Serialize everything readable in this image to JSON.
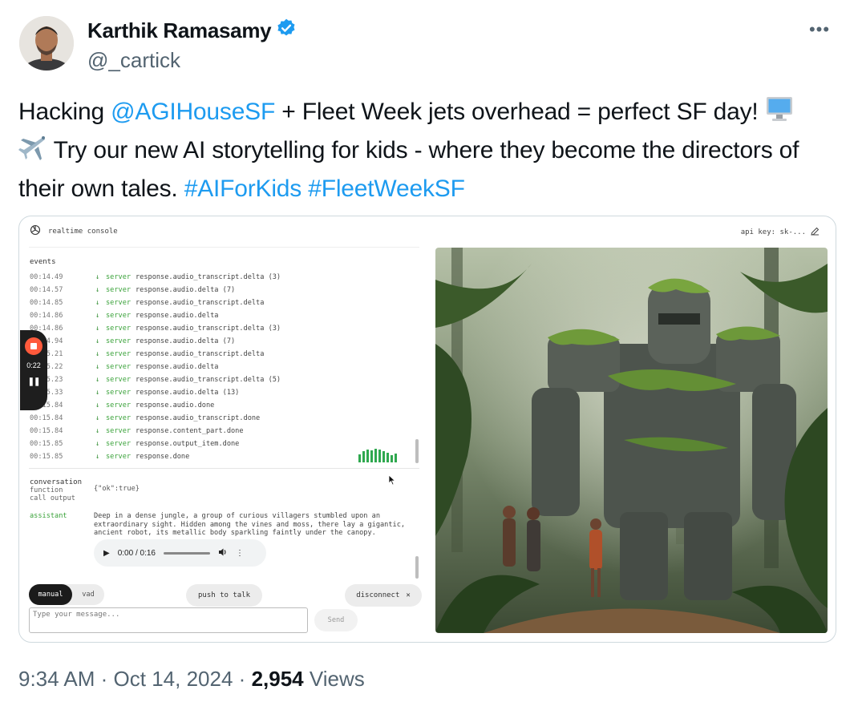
{
  "author": {
    "display_name": "Karthik Ramasamy",
    "handle": "@_cartick",
    "verified_icon": "verified-badge-icon"
  },
  "more_icon": "more-horizontal-icon",
  "tweet": {
    "part1": "Hacking ",
    "mention": "@AGIHouseSF",
    "part2": " + Fleet Week jets overhead = perfect SF day! ",
    "emoji_computer": "computer-emoji",
    "emoji_airplane": "airplane-emoji",
    "part3": " Try our new AI storytelling for kids - where they become the directors of their own tales. ",
    "hashtag1": "#AIForKids",
    "hashtag2": "#FleetWeekSF",
    "link_color": "#1d9bf0"
  },
  "console": {
    "app_name": "realtime console",
    "logo_icon": "openai-logo-icon",
    "api_key_label": "api key: sk-...",
    "edit_icon": "edit-icon",
    "events_title": "events",
    "events": [
      {
        "ts": "00:14.49",
        "src": "server",
        "type": "response.audio_transcript.delta (3)"
      },
      {
        "ts": "00:14.57",
        "src": "server",
        "type": "response.audio.delta (7)"
      },
      {
        "ts": "00:14.85",
        "src": "server",
        "type": "response.audio_transcript.delta"
      },
      {
        "ts": "00:14.86",
        "src": "server",
        "type": "response.audio.delta"
      },
      {
        "ts": "00:14.86",
        "src": "server",
        "type": "response.audio_transcript.delta (3)"
      },
      {
        "ts": "00:14.94",
        "src": "server",
        "type": "response.audio.delta (7)"
      },
      {
        "ts": "00:15.21",
        "src": "server",
        "type": "response.audio_transcript.delta"
      },
      {
        "ts": "00:15.22",
        "src": "server",
        "type": "response.audio.delta"
      },
      {
        "ts": "00:15.23",
        "src": "server",
        "type": "response.audio_transcript.delta (5)"
      },
      {
        "ts": "00:15.33",
        "src": "server",
        "type": "response.audio.delta (13)"
      },
      {
        "ts": "00:15.84",
        "src": "server",
        "type": "response.audio.done"
      },
      {
        "ts": "00:15.84",
        "src": "server",
        "type": "response.audio_transcript.done"
      },
      {
        "ts": "00:15.84",
        "src": "server",
        "type": "response.content_part.done"
      },
      {
        "ts": "00:15.85",
        "src": "server",
        "type": "response.output_item.done"
      },
      {
        "ts": "00:15.85",
        "src": "server",
        "type": "response.done"
      }
    ],
    "conversation_title": "conversation",
    "function_label": "function",
    "call_output_label": "call output",
    "function_output": "{\"ok\":true}",
    "assistant_role": "assistant",
    "assistant_message": "Deep in a dense jungle, a group of curious villagers stumbled upon an extraordinary sight. Hidden among the vines and moss, there lay a gigantic, ancient robot, its metallic body sparkling faintly under the canopy.",
    "audio": {
      "time": "0:00 / 0:16",
      "progress": 0
    },
    "mode_manual": "manual",
    "mode_vad": "vad",
    "push_to_talk": "push to talk",
    "disconnect": "disconnect",
    "message_placeholder": "Type your message...",
    "send": "Send",
    "recorder_time": "0:22",
    "image_subject": "moss-covered giant robot in jungle with villagers"
  },
  "footer": {
    "time": "9:34 AM",
    "date": "Oct 14, 2024",
    "views_count": "2,954",
    "views_label": "Views"
  }
}
